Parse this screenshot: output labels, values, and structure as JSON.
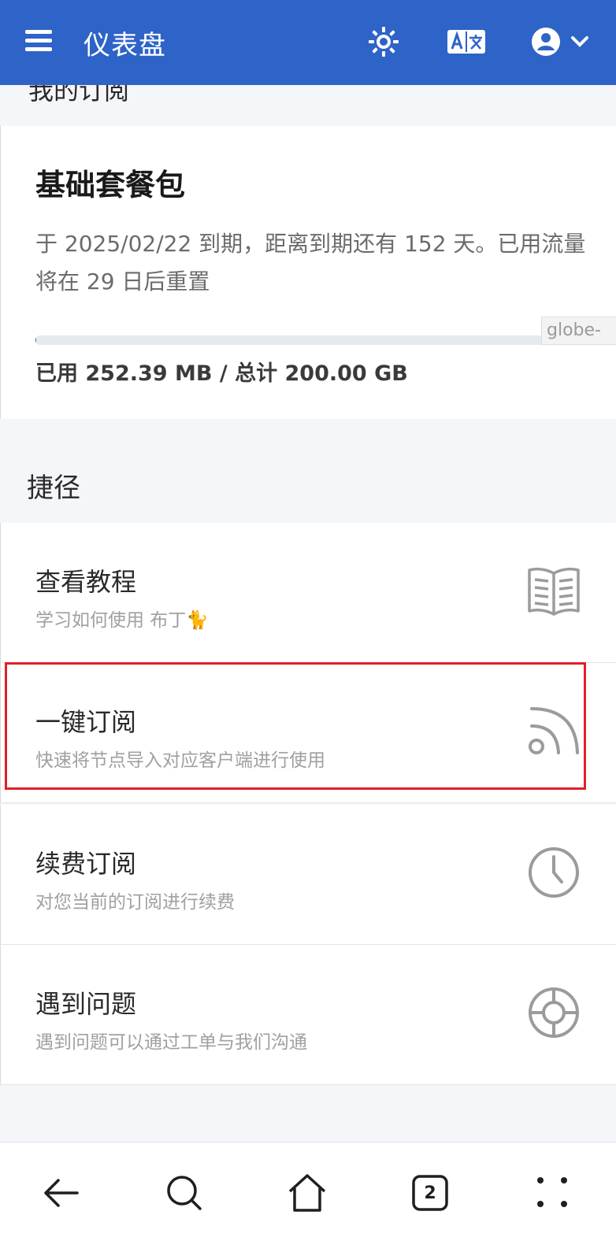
{
  "topbar": {
    "title": "仪表盘",
    "menu_icon": "hamburger-menu-icon",
    "theme_icon": "sun-icon",
    "language_icon": "translate-icon",
    "user_icon": "user-circle-icon",
    "dropdown_icon": "chevron-down-icon",
    "color": "#2e63c8"
  },
  "subscription_section": {
    "header": "我的订阅",
    "plan_name": "基础套餐包",
    "expiry_text": "于 2025/02/22 到期，距离到期还有 152 天。已用流量将在 29 日后重置",
    "usage_text": "已用 252.39 MB / 总计 200.00 GB",
    "usage_fraction": 0.0012,
    "tooltip": "globe-"
  },
  "shortcuts": {
    "header": "捷径",
    "items": [
      {
        "title": "查看教程",
        "desc": "学习如何使用 布丁🐈",
        "icon": "book-open-icon"
      },
      {
        "title": "一键订阅",
        "desc": "快速将节点导入对应客户端进行使用",
        "icon": "rss-feed-icon"
      },
      {
        "title": "续费订阅",
        "desc": "对您当前的订阅进行续费",
        "icon": "clock-icon"
      },
      {
        "title": "遇到问题",
        "desc": "遇到问题可以通过工单与我们沟通",
        "icon": "lifebuoy-icon"
      }
    ]
  },
  "browser_nav": {
    "back_icon": "back-arrow-icon",
    "search_icon": "search-icon",
    "home_icon": "home-icon",
    "tabs_count": "2",
    "more_icon": "more-dots-icon"
  }
}
